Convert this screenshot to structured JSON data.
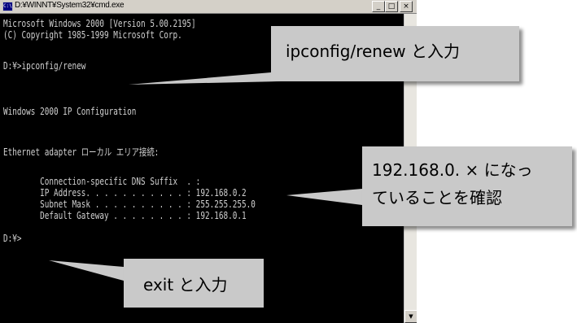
{
  "window": {
    "title": "D:¥WINNT¥System32¥cmd.exe",
    "icon_label": "C:\\",
    "controls": {
      "minimize": "_",
      "maximize": "□",
      "close": "×"
    }
  },
  "console": {
    "lines": [
      "Microsoft Windows 2000 [Version 5.00.2195]",
      "(C) Copyright 1985-1999 Microsoft Corp.",
      "",
      "D:¥>ipconfig/renew",
      "",
      "Windows 2000 IP Configuration",
      "",
      "",
      "Ethernet adapter ローカル エリア接続:",
      "",
      "        Connection-specific DNS Suffix  . :",
      "        IP Address. . . . . . . . . . . : 192.168.0.2",
      "        Subnet Mask . . . . . . . . . . : 255.255.255.0",
      "        Default Gateway . . . . . . . . : 192.168.0.1",
      "",
      "D:¥>"
    ]
  },
  "callouts": {
    "renew": "ipconfig/renew と入力",
    "ip_line1": "192.168.0. × になっ",
    "ip_line2": "ていることを確認",
    "exit": "exit と入力"
  },
  "colors": {
    "console_bg": "#000000",
    "console_text": "#d0d0d0",
    "titlebar": "#d4d0c8",
    "callout_bg": "#c9c9c9"
  }
}
